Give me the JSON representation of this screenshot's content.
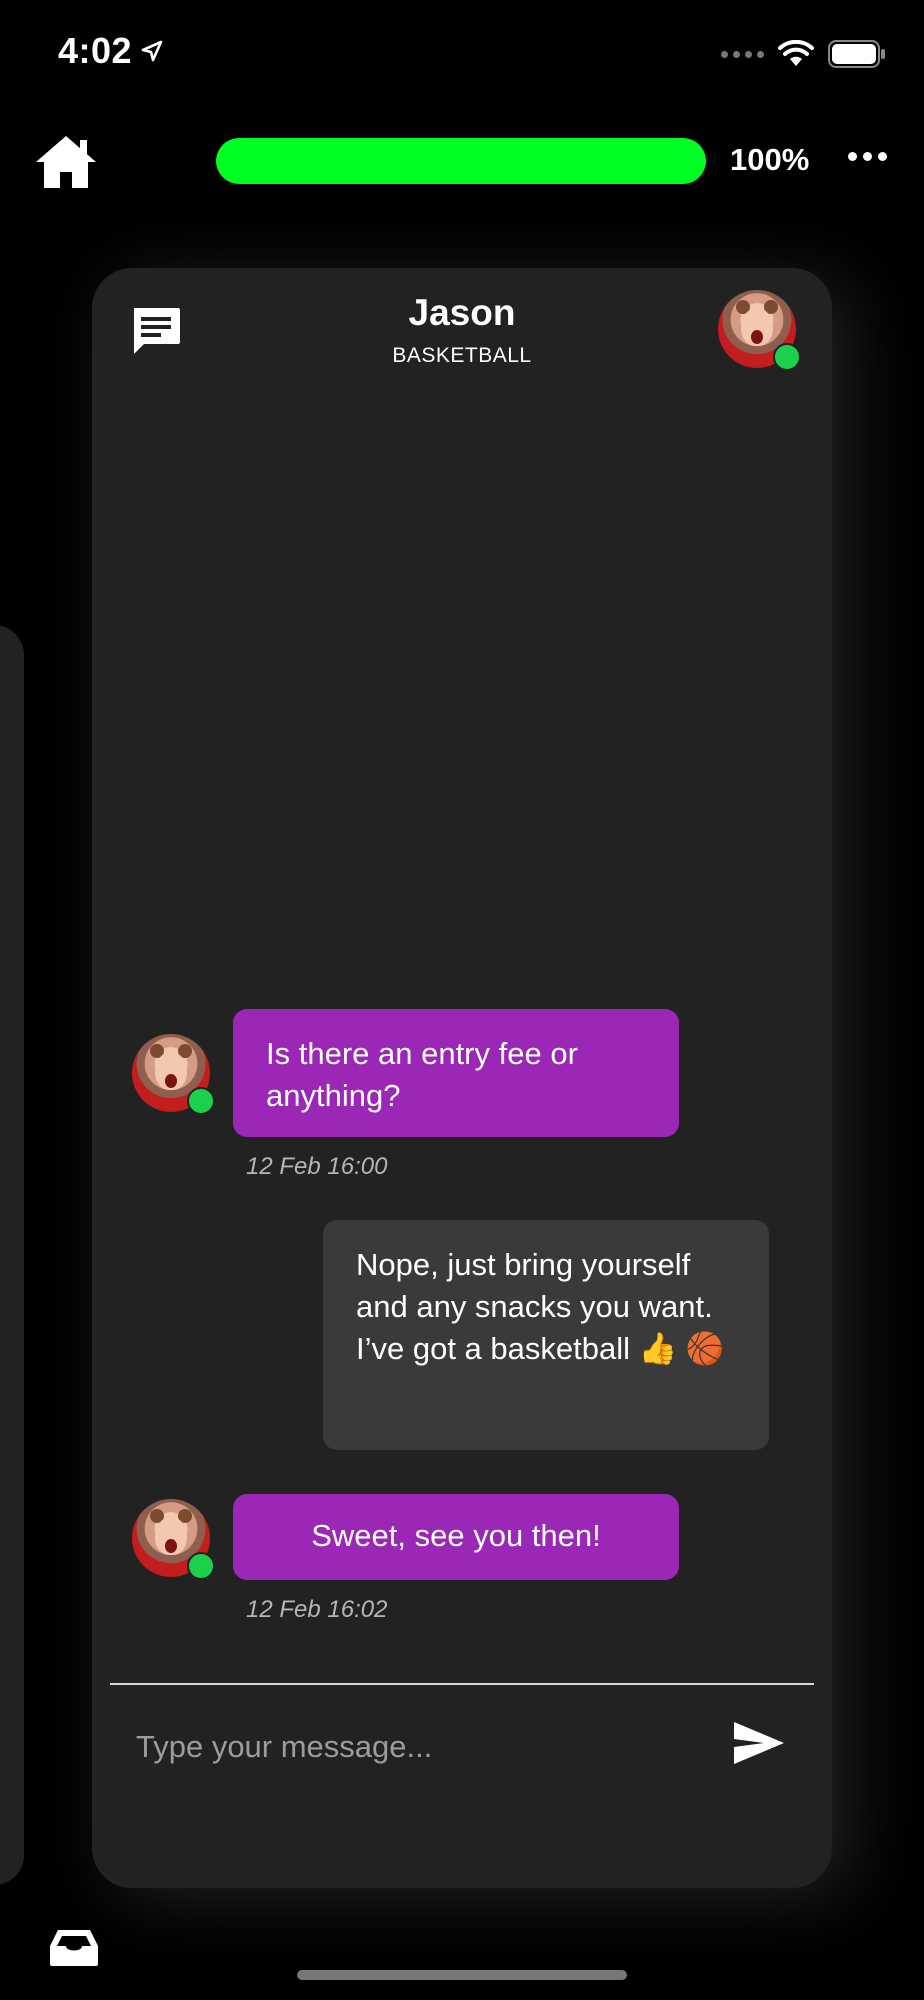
{
  "status_bar": {
    "time": "4:02",
    "location_icon": "location-arrow-icon",
    "wifi_icon": "wifi-icon",
    "battery_icon": "battery-icon"
  },
  "top_bar": {
    "home_icon": "home-icon",
    "progress": {
      "percent_fraction": 1.0,
      "label": "100%",
      "fill_color": "#00ff22"
    },
    "more_icon": "more-icon"
  },
  "chat_card": {
    "chat_icon": "chat-icon",
    "name": "Jason",
    "subtitle": "BASKETBALL",
    "online_color": "#1bd14b",
    "messages": [
      {
        "sender": "Jason",
        "text": "Is there an entry fee or anything?",
        "timestamp": "12 Feb 16:00",
        "color": "#9b27b6"
      },
      {
        "sender": "me",
        "text": "Nope, just bring yourself and any snacks you want. I’ve got a basketball 👍 🏀",
        "color": "#3a3a3a"
      },
      {
        "sender": "Jason",
        "text": "Sweet, see you then!",
        "timestamp": "12 Feb 16:02",
        "color": "#9b27b6"
      }
    ],
    "input": {
      "placeholder": "Type your message...",
      "value": ""
    },
    "send_icon": "send-icon"
  },
  "bottom_bar": {
    "inbox_icon": "inbox-icon"
  }
}
